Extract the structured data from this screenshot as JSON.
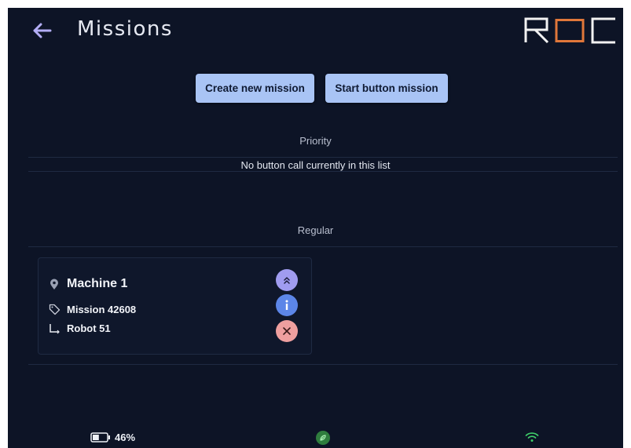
{
  "header": {
    "title": "Missions",
    "logo_text": "ROC"
  },
  "actions": {
    "create_label": "Create new mission",
    "start_label": "Start button mission"
  },
  "priority": {
    "label": "Priority",
    "empty_message": "No button call currently in this list"
  },
  "regular": {
    "label": "Regular",
    "missions": [
      {
        "location": "Machine 1",
        "mission": "Mission 42608",
        "robot": "Robot 51"
      }
    ]
  },
  "status": {
    "battery_percent": "46%",
    "battery_level": 0.46
  },
  "icons": {
    "back": "back-arrow-icon",
    "location": "map-pin-icon",
    "tag": "tag-icon",
    "robot": "robot-path-icon",
    "prioritize": "double-chevron-up-icon",
    "info": "info-icon",
    "cancel": "close-icon",
    "battery": "battery-icon",
    "status": "leaf-status-icon",
    "wifi": "wifi-icon"
  },
  "colors": {
    "background": "#0d1426",
    "button": "#a9c4f5",
    "accent_orange": "#e0773a",
    "prioritize": "#a09cf0",
    "info": "#5c86e8",
    "cancel": "#ee9f9f",
    "status_green": "#2f7d3e",
    "wifi_green": "#3fcf6a"
  }
}
